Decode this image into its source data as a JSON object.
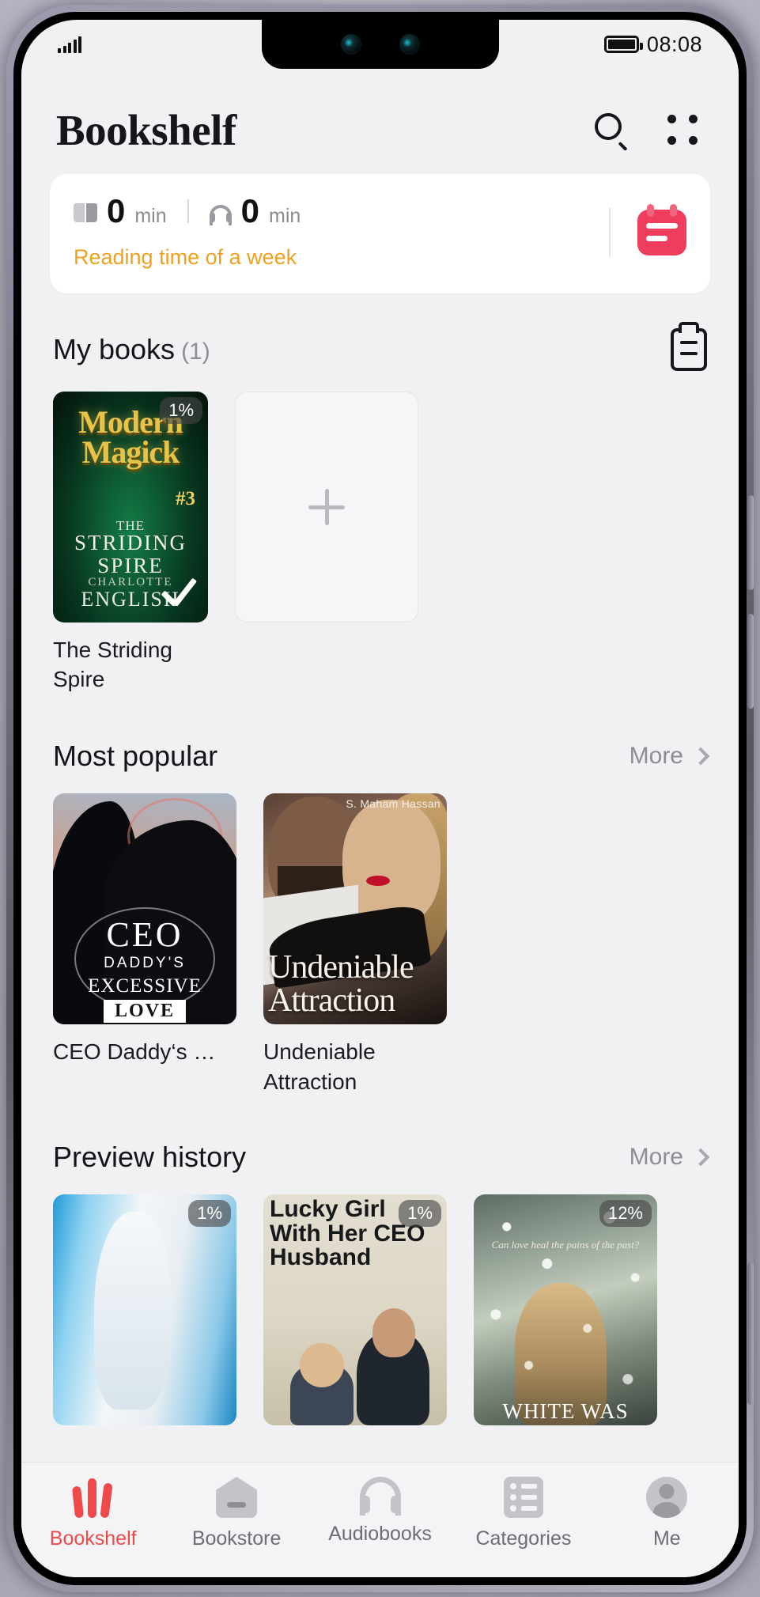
{
  "status_bar": {
    "signal_icon": "signal-bars-icon",
    "battery_icon": "battery-full-icon",
    "time": "08:08"
  },
  "app_bar": {
    "title": "Bookshelf",
    "search_icon": "search-icon",
    "menu_icon": "four-dot-grid-icon"
  },
  "reading_card": {
    "book_icon": "open-book-icon",
    "read_minutes": "0",
    "read_unit": "min",
    "headphone_icon": "headphones-icon",
    "listen_minutes": "0",
    "listen_unit": "min",
    "subtitle": "Reading time of a week",
    "subtitle_color": "#f0a020",
    "calendar_icon": "calendar-icon",
    "calendar_color": "#ef3d5e"
  },
  "my_books": {
    "title": "My books",
    "count": "(1)",
    "note_icon": "note-list-icon",
    "add_icon": "plus-icon",
    "items": [
      {
        "title": "The Striding Spire",
        "progress": "1%",
        "finished_icon": "check-icon",
        "cover": {
          "title_line1": "Modern",
          "title_line2": "Magick",
          "number": "#3",
          "sub1": "THE",
          "sub2": "STRIDING",
          "sub3": "SPIRE",
          "author_first": "CHARLOTTE",
          "author_last": "ENGLISH"
        }
      }
    ]
  },
  "most_popular": {
    "title": "Most popular",
    "more_label": "More",
    "more_icon": "chevron-right-icon",
    "items": [
      {
        "title": "CEO Daddy‘s …",
        "cover": {
          "l1": "CEO",
          "l2": "DADDY'S",
          "l3": "EXCESSIVE",
          "l4": "LOVE"
        }
      },
      {
        "title": "Undeniable Attraction",
        "cover": {
          "author": "S. Maham Hassan",
          "l1": "Undeniable",
          "l2": "Attraction"
        }
      }
    ]
  },
  "preview_history": {
    "title": "Preview history",
    "more_label": "More",
    "more_icon": "chevron-right-icon",
    "items": [
      {
        "progress": "1%",
        "cover_text": ""
      },
      {
        "progress": "1%",
        "cover_text": "Lucky Girl With Her CEO Husband"
      },
      {
        "progress": "12%",
        "cover_text": "WHITE WAS",
        "tagline": "Can love heal the pains of the past?"
      }
    ]
  },
  "tab_bar": {
    "active": "Bookshelf",
    "active_color": "#ef4a4a",
    "items": [
      {
        "label": "Bookshelf",
        "icon": "bookshelf-icon"
      },
      {
        "label": "Bookstore",
        "icon": "store-icon"
      },
      {
        "label": "Audiobooks",
        "icon": "headphones-icon"
      },
      {
        "label": "Categories",
        "icon": "categories-list-icon"
      },
      {
        "label": "Me",
        "icon": "user-avatar-icon"
      }
    ]
  }
}
